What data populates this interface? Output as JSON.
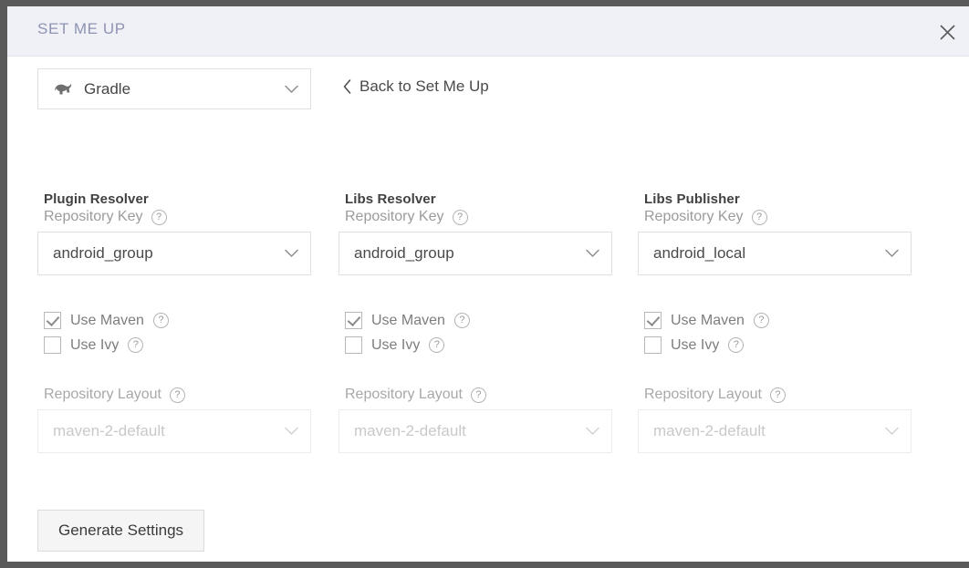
{
  "modal": {
    "title": "SET ME UP",
    "close_icon": "close-icon"
  },
  "toolbar": {
    "tool_select": {
      "value": "Gradle",
      "icon": "gradle-elephant-icon",
      "chevron": "chevron-down-icon"
    },
    "back_link": {
      "label": "Back to Set Me Up",
      "icon": "chevron-left-icon"
    }
  },
  "help_glyph": "?",
  "columns": [
    {
      "title": "Plugin Resolver",
      "repository_key": {
        "label": "Repository Key",
        "value": "android_group",
        "placeholder": "Select repository"
      },
      "checkboxes": [
        {
          "label": "Use Maven",
          "checked": true
        },
        {
          "label": "Use Ivy",
          "checked": false
        }
      ],
      "repository_layout": {
        "label": "Repository Layout",
        "value": "maven-2-default",
        "disabled": true
      }
    },
    {
      "title": "Libs Resolver",
      "repository_key": {
        "label": "Repository Key",
        "value": "android_group",
        "placeholder": "Select repository"
      },
      "checkboxes": [
        {
          "label": "Use Maven",
          "checked": true
        },
        {
          "label": "Use Ivy",
          "checked": false
        }
      ],
      "repository_layout": {
        "label": "Repository Layout",
        "value": "maven-2-default",
        "disabled": true
      }
    },
    {
      "title": "Libs Publisher",
      "repository_key": {
        "label": "Repository Key",
        "value": "android_local",
        "placeholder": "Select repository"
      },
      "checkboxes": [
        {
          "label": "Use Maven",
          "checked": true
        },
        {
          "label": "Use Ivy",
          "checked": false
        }
      ],
      "repository_layout": {
        "label": "Repository Layout",
        "value": "maven-2-default",
        "disabled": true
      }
    }
  ],
  "footer": {
    "generate_label": "Generate Settings"
  },
  "colors": {
    "header_bg": "#f0f1f6",
    "title_text": "#8e93b3",
    "page_chrome": "#5a5a5a",
    "border": "#e0e0e0",
    "disabled_text": "#c9c9c9"
  }
}
